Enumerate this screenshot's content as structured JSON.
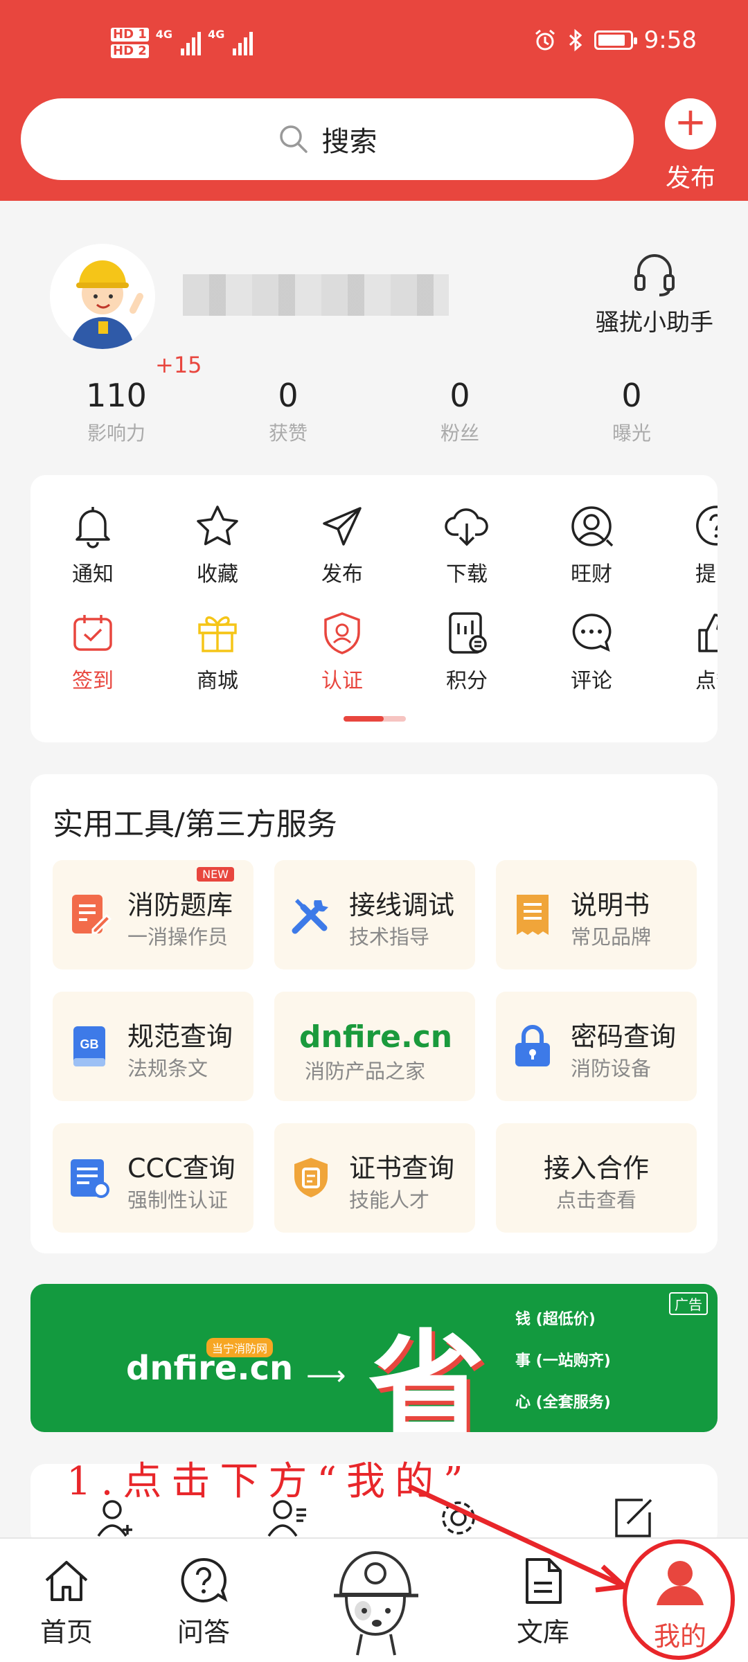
{
  "status_bar": {
    "time": "9:58",
    "sim1": "HD 1",
    "sim2": "HD 2",
    "net1": "4G",
    "net2": "4G"
  },
  "search": {
    "placeholder": "搜索"
  },
  "publish": {
    "label": "发布"
  },
  "profile": {
    "helper_label": "骚扰小助手",
    "influence_bonus": "+15",
    "stats": [
      {
        "value": "110",
        "label": "影响力"
      },
      {
        "value": "0",
        "label": "获赞"
      },
      {
        "value": "0",
        "label": "粉丝"
      },
      {
        "value": "0",
        "label": "曝光"
      }
    ]
  },
  "grid": {
    "row1": [
      {
        "label": "通知",
        "icon": "bell-icon"
      },
      {
        "label": "收藏",
        "icon": "star-icon"
      },
      {
        "label": "发布",
        "icon": "send-icon"
      },
      {
        "label": "下载",
        "icon": "cloud-download-icon"
      },
      {
        "label": "旺财",
        "icon": "user-circle-icon"
      },
      {
        "label": "提问",
        "icon": "question-icon"
      }
    ],
    "row2": [
      {
        "label": "签到",
        "icon": "calendar-check-icon"
      },
      {
        "label": "商城",
        "icon": "gift-icon"
      },
      {
        "label": "认证",
        "icon": "shield-icon"
      },
      {
        "label": "积分",
        "icon": "points-icon"
      },
      {
        "label": "评论",
        "icon": "comment-icon"
      },
      {
        "label": "点赞",
        "icon": "thumb-up-icon"
      }
    ]
  },
  "tools": {
    "title": "实用工具/第三方服务",
    "new_badge": "NEW",
    "items": [
      {
        "title": "消防题库",
        "subtitle": "一消操作员"
      },
      {
        "title": "接线调试",
        "subtitle": "技术指导"
      },
      {
        "title": "说明书",
        "subtitle": "常见品牌"
      },
      {
        "title": "规范查询",
        "subtitle": "法规条文"
      },
      {
        "title": "dnfire.cn",
        "subtitle": "消防产品之家"
      },
      {
        "title": "密码查询",
        "subtitle": "消防设备"
      },
      {
        "title": "CCC查询",
        "subtitle": "强制性认证"
      },
      {
        "title": "证书查询",
        "subtitle": "技能人才"
      },
      {
        "title": "接入合作",
        "subtitle": "点击查看"
      }
    ]
  },
  "banner": {
    "ad_tag": "广告",
    "brand": "dnfire.cn",
    "brand_sub": "当宁消防网",
    "big_char": "省",
    "lines": [
      "钱 (超低价)",
      "事 (一站购齐)",
      "心 (全套服务)"
    ]
  },
  "annotation": {
    "instruction": "1.点击下方“我的”"
  },
  "tabbar": {
    "home": "首页",
    "qa": "问答",
    "library": "文库",
    "mine": "我的"
  },
  "colors": {
    "brand_red": "#e8463e",
    "banner_green": "#139a3f",
    "tool_bg": "#fdf7ec"
  }
}
